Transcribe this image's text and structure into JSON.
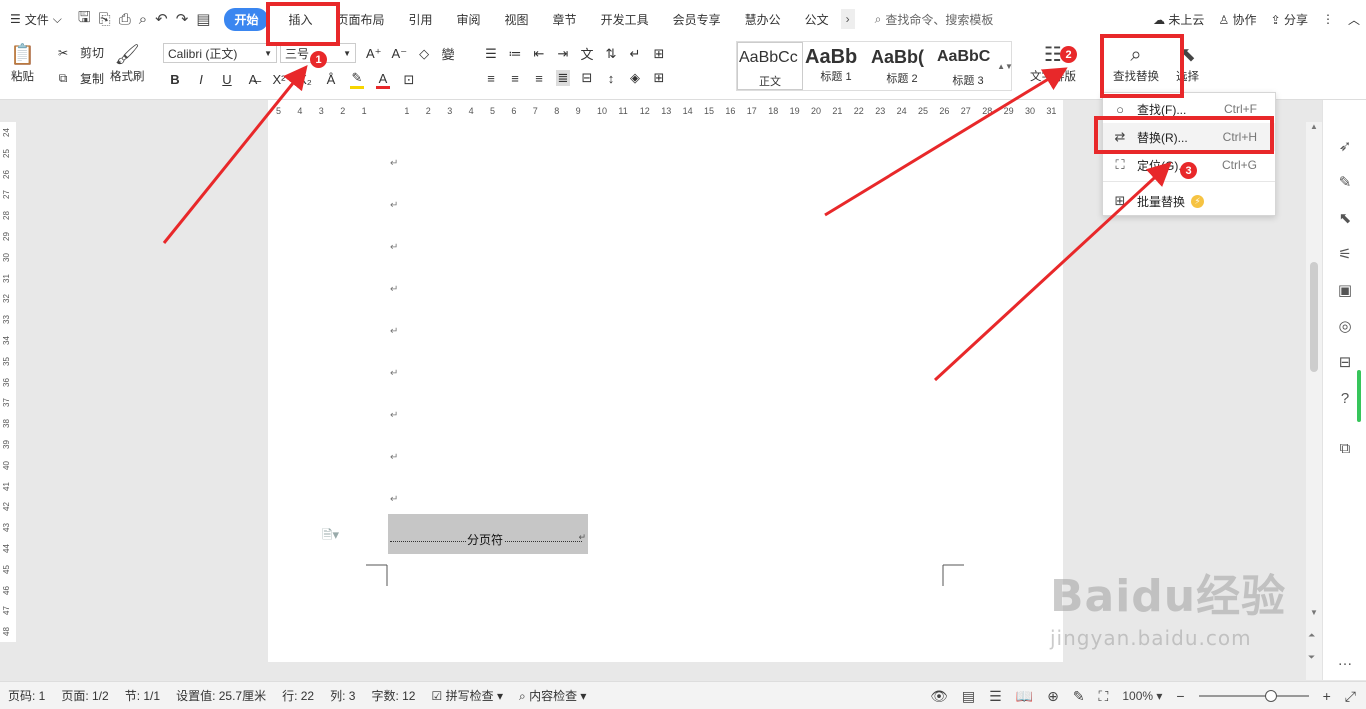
{
  "menubar": {
    "file_label": "文件",
    "tabs": [
      "开始",
      "插入",
      "页面布局",
      "引用",
      "审阅",
      "视图",
      "章节",
      "开发工具",
      "会员专享",
      "慧办公",
      "公文"
    ],
    "search_placeholder": "查找命令、搜索模板",
    "cloud_label": "未上云",
    "collab_label": "协作",
    "share_label": "分享"
  },
  "ribbon": {
    "paste_label": "粘贴",
    "cut_label": "剪切",
    "copy_label": "复制",
    "format_painter_label": "格式刷",
    "font_name": "Calibri (正文)",
    "font_size": "三号",
    "styles": [
      {
        "sample": "AaBbCc",
        "name": "正文"
      },
      {
        "sample": "AaBb",
        "name": "标题 1"
      },
      {
        "sample": "AaBb(",
        "name": "标题 2"
      },
      {
        "sample": "AaBbC",
        "name": "标题 3"
      }
    ],
    "text_layout_label": "文字排版",
    "find_replace_label": "查找替换",
    "select_label": "选择"
  },
  "ruler": {
    "h_ticks": [
      "5",
      "4",
      "3",
      "2",
      "1",
      "",
      "1",
      "2",
      "3",
      "4",
      "5",
      "6",
      "7",
      "8",
      "9",
      "10",
      "11",
      "12",
      "13",
      "14",
      "15",
      "16",
      "17",
      "18",
      "19",
      "20",
      "21",
      "22",
      "23",
      "24",
      "25",
      "26",
      "27",
      "28",
      "29",
      "30",
      "31"
    ],
    "v_ticks": [
      "24",
      "25",
      "26",
      "27",
      "28",
      "29",
      "30",
      "31",
      "32",
      "33",
      "34",
      "35",
      "36",
      "37",
      "38",
      "39",
      "40",
      "41",
      "42",
      "43",
      "44",
      "45",
      "46",
      "47",
      "48"
    ]
  },
  "document": {
    "paragraph_mark": "↵",
    "page_break_label": "分页符"
  },
  "dropdown": {
    "items": [
      {
        "label": "查找(F)...",
        "shortcut": "Ctrl+F"
      },
      {
        "label": "替换(R)...",
        "shortcut": "Ctrl+H"
      },
      {
        "label": "定位(G)...",
        "shortcut": "Ctrl+G"
      },
      {
        "label": "批量替换",
        "shortcut": ""
      }
    ]
  },
  "statusbar": {
    "page_no": "页码: 1",
    "pages": "页面: 1/2",
    "section": "节: 1/1",
    "setting": "设置值: 25.7厘米",
    "line": "行: 22",
    "column": "列: 3",
    "word_count": "字数: 12",
    "spell_check": "拼写检查",
    "content_check": "内容检查",
    "zoom": "100%"
  },
  "annotations": {
    "badge1": "1",
    "badge2": "2",
    "badge3": "3",
    "color": "#e8282a"
  },
  "watermark": {
    "logo": "Baidu经验",
    "url": "jingyan.baidu.com"
  }
}
